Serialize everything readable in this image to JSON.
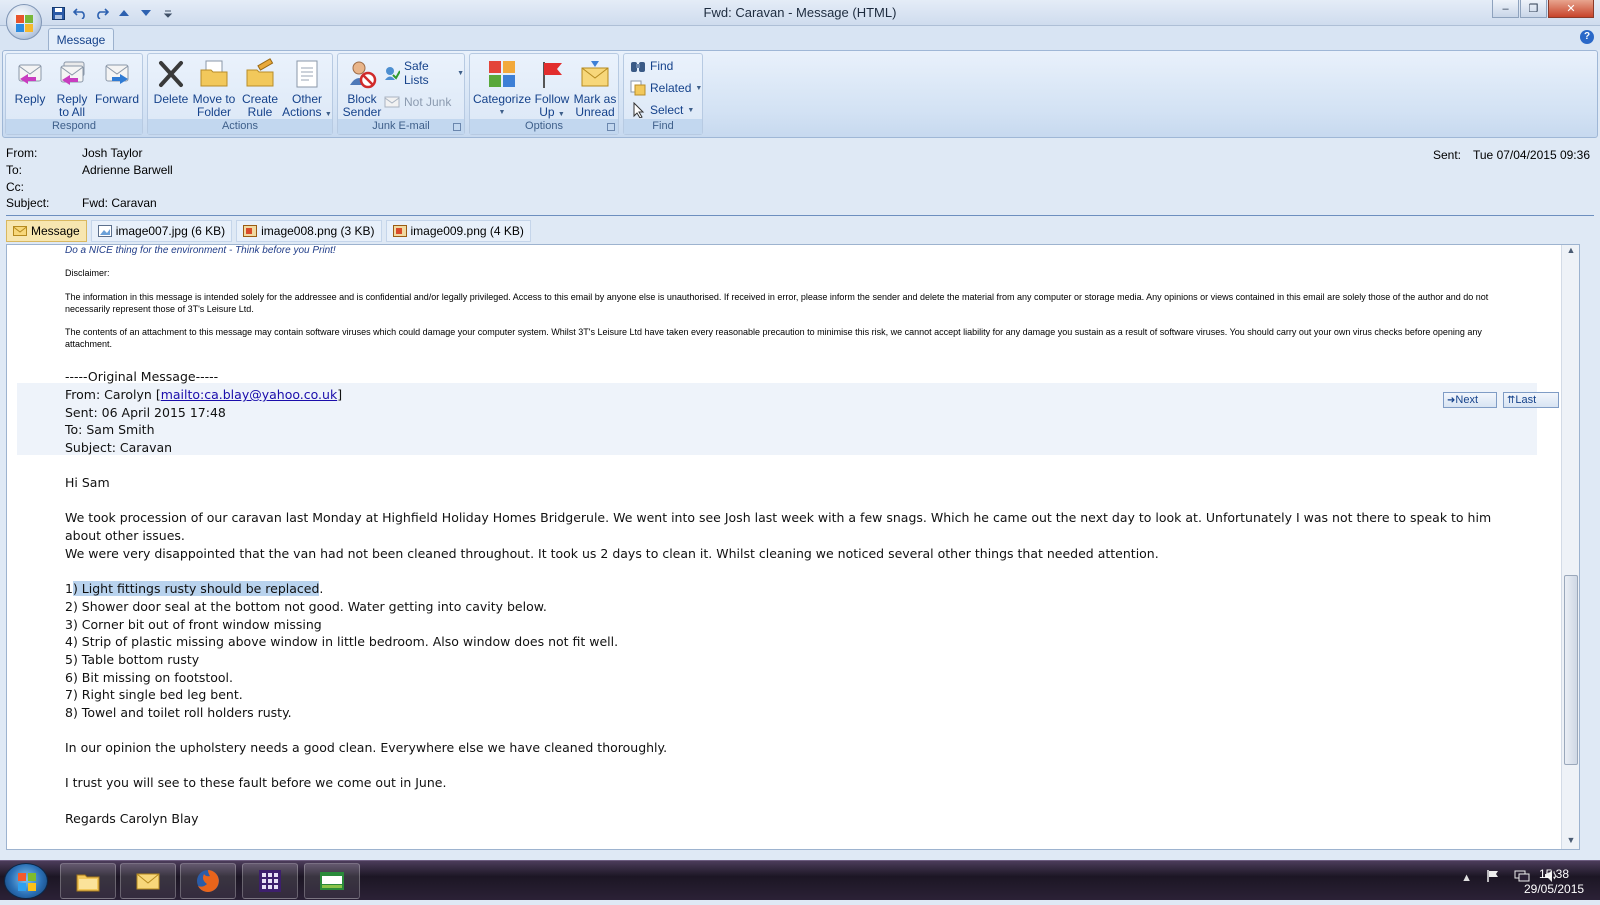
{
  "window": {
    "title": "Fwd: Caravan - Message (HTML)",
    "minimize": "–",
    "restore": "❐",
    "close": "✕"
  },
  "tabs": {
    "message": "Message"
  },
  "help_icon": "?",
  "ribbon": {
    "respond": {
      "label": "Respond",
      "reply": "Reply",
      "reply_all_1": "Reply",
      "reply_all_2": "to All",
      "forward": "Forward"
    },
    "actions": {
      "label": "Actions",
      "delete": "Delete",
      "move_1": "Move to",
      "move_2": "Folder",
      "create_1": "Create",
      "create_2": "Rule",
      "other_1": "Other",
      "other_2": "Actions"
    },
    "junk": {
      "label": "Junk E-mail",
      "block_1": "Block",
      "block_2": "Sender",
      "safe_lists": "Safe Lists",
      "not_junk": "Not Junk"
    },
    "options": {
      "label": "Options",
      "categorize": "Categorize",
      "follow_1": "Follow",
      "follow_2": "Up",
      "mark_1": "Mark as",
      "mark_2": "Unread"
    },
    "find": {
      "label": "Find",
      "find": "Find",
      "related": "Related",
      "select": "Select"
    }
  },
  "header": {
    "from_label": "From:",
    "from": "Josh Taylor",
    "to_label": "To:",
    "to": "Adrienne Barwell",
    "cc_label": "Cc:",
    "cc": "",
    "subject_label": "Subject:",
    "subject": "Fwd: Caravan",
    "sent_label": "Sent:",
    "sent": "Tue 07/04/2015 09:36"
  },
  "attachments": [
    {
      "label": "Message"
    },
    {
      "label": "image007.jpg (6 KB)"
    },
    {
      "label": "image008.png (3 KB)"
    },
    {
      "label": "image009.png (4 KB)"
    }
  ],
  "body": {
    "eco": "Do a NICE thing for the environment - Think before you Print!",
    "disclaimer_title": "Disclaimer:",
    "disclaimer_1": "The information in this message is intended solely for the addressee and is confidential and/or legally privileged. Access to this email by anyone else is unauthorised. If received in error, please inform the sender and delete the material from any computer or storage media. Any opinions or views contained in this email are solely those of the author and do not necessarily represent those of 3T's Leisure Ltd.",
    "disclaimer_2": "The contents of an attachment to this message may contain software viruses which could damage your computer system. Whilst 3T's Leisure Ltd have taken every reasonable precaution to minimise this risk, we cannot accept liability for any damage you sustain as a result of software viruses. You should carry out your own virus checks before opening any attachment.",
    "orig_marker": "-----Original Message-----",
    "orig_from_prefix": "From: Carolyn [",
    "orig_from_link": "mailto:ca.blay@yahoo.co.uk",
    "orig_from_suffix": "]",
    "orig_sent": "Sent: 06 April 2015 17:48",
    "orig_to": "To: Sam Smith",
    "orig_subject": "Subject: Caravan",
    "nav_next": "Next",
    "nav_last": "Last",
    "greeting": "Hi Sam",
    "para1": "We took procession of our caravan last Monday at Highfield Holiday Homes Bridgerule. We went into see Josh last week with a few snags. Which he came out the next day to look at. Unfortunately I was not there to speak to him about other issues.",
    "para2": "We were very disappointed that the van had not been cleaned throughout. It took us 2 days to clean it. Whilst cleaning we noticed several other things that needed attention.",
    "item1_prefix": "1",
    "item1_highlight": ") Light fittings rusty should be replaced",
    "item1_suffix": ".",
    "items": [
      "2) Shower door seal at the bottom not good. Water getting into cavity below.",
      "3) Corner bit out of front window missing",
      "4) Strip of plastic missing above window in little bedroom. Also window does not fit well.",
      "5) Table bottom rusty",
      "6) Bit missing on footstool.",
      "7) Right single bed leg bent.",
      "8) Towel and toilet roll holders rusty."
    ],
    "para3": "In our opinion the upholstery needs a good clean. Everywhere else we have cleaned thoroughly.",
    "para4": "I trust you will see to these fault before we come out in June.",
    "sign": "Regards Carolyn Blay"
  },
  "taskbar": {
    "time": "15:38",
    "date": "29/05/2015",
    "apps": [
      "file-explorer-icon",
      "outlook-icon",
      "firefox-icon",
      "calculator-app-icon",
      "sage-icon"
    ]
  },
  "colors": {
    "ribbon_text": "#15428b",
    "highlight": "#b9d3ee",
    "link": "#1a0dab"
  }
}
